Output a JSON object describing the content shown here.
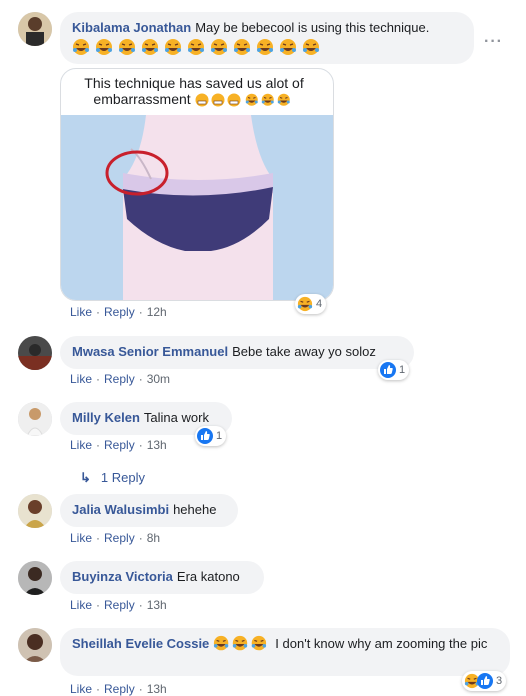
{
  "comments": [
    {
      "name": "Kibalama Jonathan",
      "text": "May be bebecool is using this technique.",
      "emoji_row": "laughing-emoji x11",
      "image_caption": "This technique has saved us alot of embarrassment",
      "actions": {
        "like": "Like",
        "reply": "Reply",
        "time": "12h"
      },
      "reaction": {
        "type": "haha",
        "count": "4"
      }
    },
    {
      "name": "Mwasa Senior Emmanuel",
      "text": "Bebe take away yo soloz",
      "actions": {
        "like": "Like",
        "reply": "Reply",
        "time": "30m"
      },
      "reaction": {
        "type": "like",
        "count": "1"
      }
    },
    {
      "name": "Milly Kelen",
      "text": "Talina work",
      "actions": {
        "like": "Like",
        "reply": "Reply",
        "time": "13h"
      },
      "reaction": {
        "type": "like",
        "count": "1"
      },
      "replies_label": "1 Reply"
    },
    {
      "name": "Jalia Walusimbi",
      "text": "hehehe",
      "actions": {
        "like": "Like",
        "reply": "Reply",
        "time": "8h"
      }
    },
    {
      "name": "Buyinza Victoria",
      "text": "Era katono",
      "actions": {
        "like": "Like",
        "reply": "Reply",
        "time": "13h"
      }
    },
    {
      "name": "Sheillah Evelie Cossie",
      "text": "I don't know why am zooming the pic",
      "actions": {
        "like": "Like",
        "reply": "Reply",
        "time": "13h"
      },
      "reaction": {
        "type": "haha-like",
        "count": "3"
      }
    }
  ],
  "more_icon": "ellipsis-icon",
  "colors": {
    "name": "#385898",
    "bubble": "#f2f3f5",
    "meta": "#606770",
    "like_blue": "#1877f2",
    "haha_yellow": "#f7b125"
  }
}
